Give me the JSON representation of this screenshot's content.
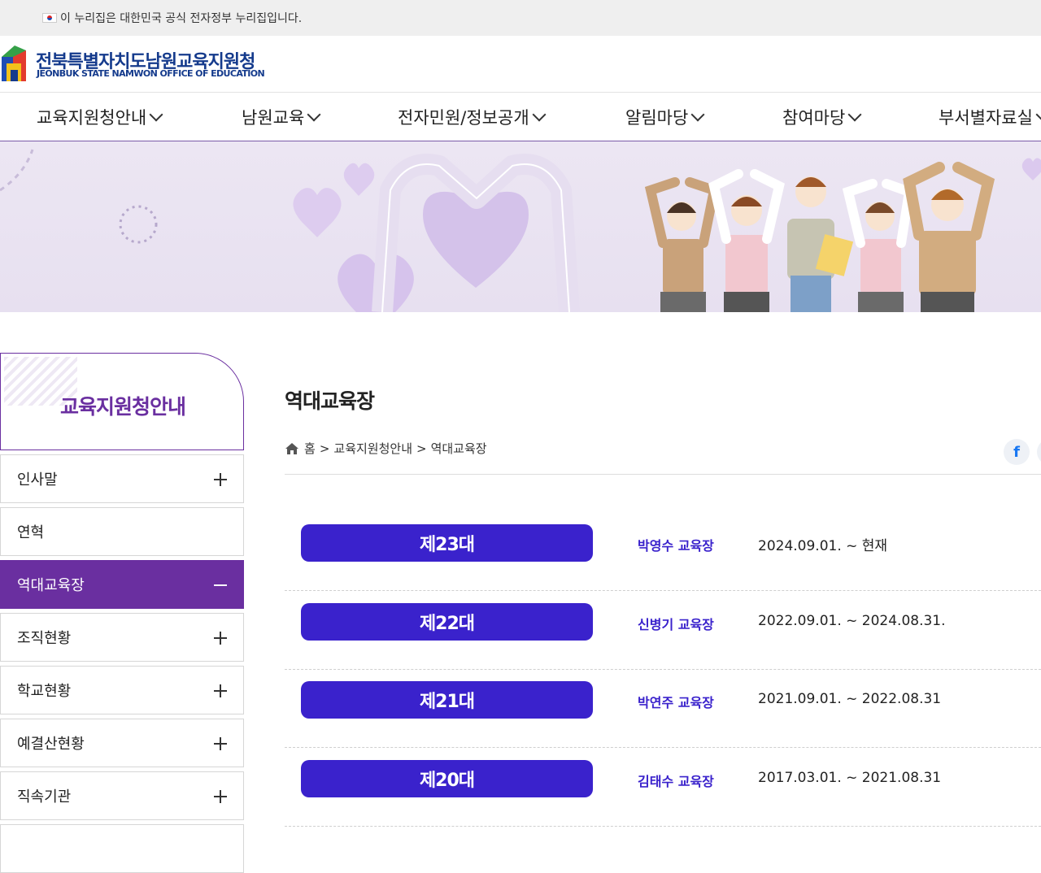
{
  "gov_bar": {
    "text": "이 누리집은 대한민국 공식 전자정부 누리집입니다."
  },
  "logo": {
    "title": "전북특별자치도남원교육지원청",
    "subtitle": "JEONBUK STATE NAMWON OFFICE OF EDUCATION"
  },
  "gnb": [
    {
      "label": "교육지원청안내"
    },
    {
      "label": "남원교육"
    },
    {
      "label": "전자민원/정보공개"
    },
    {
      "label": "알림마당"
    },
    {
      "label": "참여마당"
    },
    {
      "label": "부서별자료실"
    }
  ],
  "lnb": {
    "title": "교육지원청안내",
    "items": [
      {
        "label": "인사말",
        "state": "collapsed"
      },
      {
        "label": "연혁",
        "state": "plain"
      },
      {
        "label": "역대교육장",
        "state": "active"
      },
      {
        "label": "조직현황",
        "state": "collapsed"
      },
      {
        "label": "학교현황",
        "state": "collapsed"
      },
      {
        "label": "예결산현황",
        "state": "collapsed"
      },
      {
        "label": "직속기관",
        "state": "collapsed"
      }
    ]
  },
  "content": {
    "title": "역대교육장",
    "breadcrumb": {
      "home": "홈",
      "sep": ">",
      "level1": "교육지원청안내",
      "level2": "역대교육장"
    },
    "share_icon": "facebook-icon",
    "rows": [
      {
        "term": "제23대",
        "name": "박영수 교육장",
        "period": "2024.09.01. ~ 현재"
      },
      {
        "term": "제22대",
        "name": "신병기 교육장",
        "period": "2022.09.01. ~ 2024.08.31."
      },
      {
        "term": "제21대",
        "name": "박연주 교육장",
        "period": "2021.09.01. ~ 2022.08.31"
      },
      {
        "term": "제20대",
        "name": "김태수 교육장",
        "period": "2017.03.01. ~ 2021.08.31"
      }
    ]
  },
  "colors": {
    "accent_purple": "#6a2fa0",
    "badge_blue": "#3a22cc",
    "logo_navy": "#143a8c"
  }
}
